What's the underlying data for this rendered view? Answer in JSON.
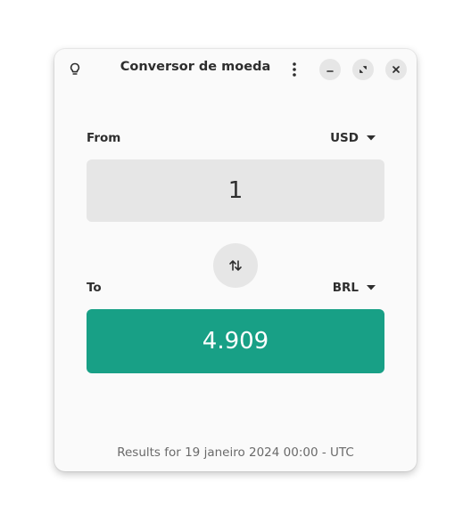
{
  "window": {
    "title": "Conversor de moeda"
  },
  "icons": {
    "tips": "lightbulb-icon",
    "menu": "vertical-dots-icon",
    "minimize": "minimize-icon",
    "maximize": "maximize-icon",
    "close": "close-icon",
    "swap": "swap-arrows-icon",
    "dropdown": "caret-down-icon"
  },
  "from": {
    "label": "From",
    "currency": "USD",
    "amount": "1"
  },
  "to": {
    "label": "To",
    "currency": "BRL",
    "amount": "4.909"
  },
  "footer": {
    "text": "Results for 19 janeiro 2024 00:00 - UTC"
  },
  "colors": {
    "result_background": "#18a086",
    "input_background": "#e6e6e6",
    "window_background": "#fafafa"
  }
}
